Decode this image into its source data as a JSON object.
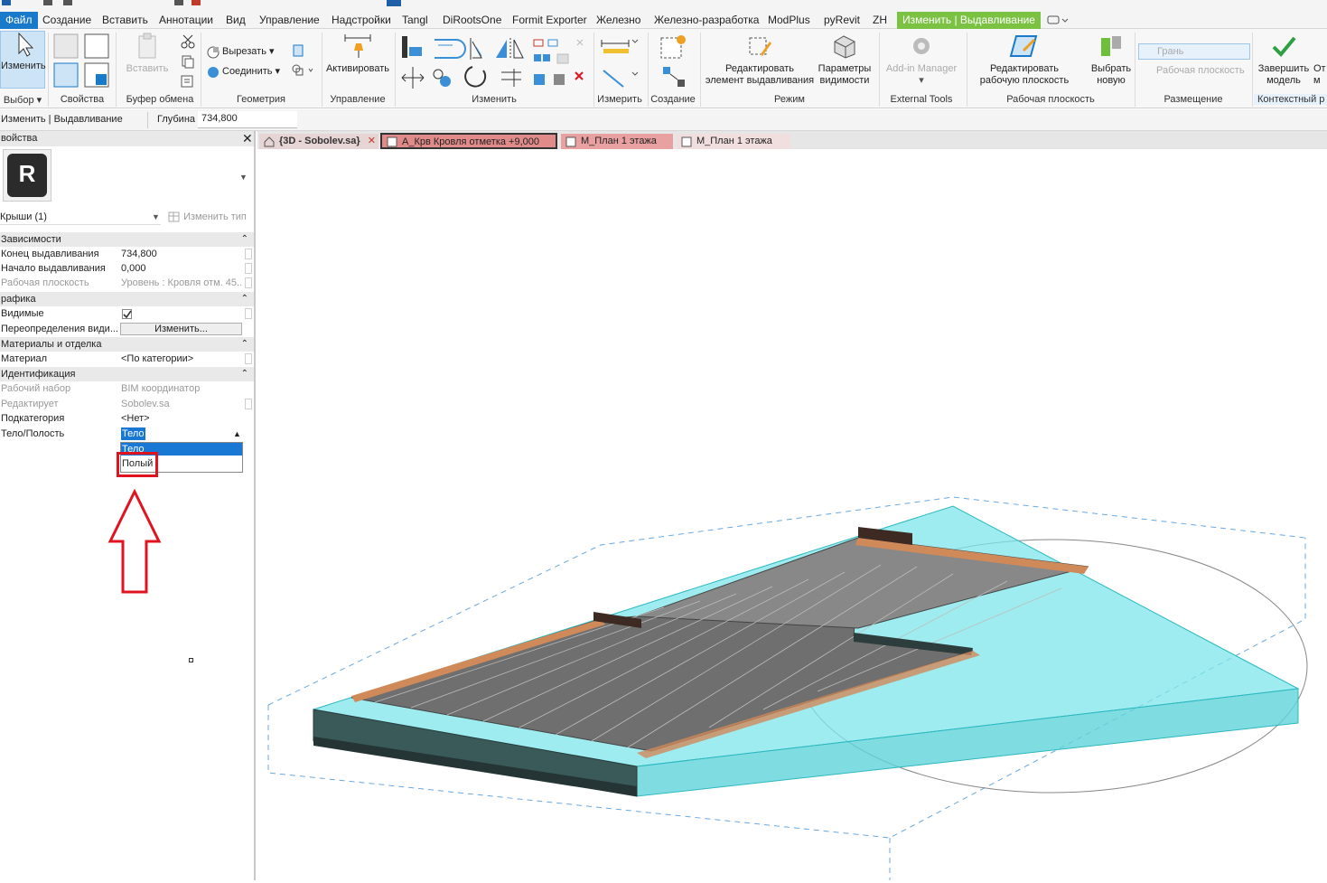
{
  "menubar": {
    "file": "Файл",
    "tabs": [
      "Создание",
      "Вставить",
      "Аннотации",
      "Вид",
      "Управление",
      "Надстройки",
      "Tangl",
      "DiRootsOne",
      "Formit Exporter",
      "Железно",
      "Железно-разработка",
      "ModPlus",
      "pyRevit",
      "ZH"
    ],
    "context_tab": "Изменить | Выдавливание"
  },
  "ribbon": {
    "modify": "Изменить",
    "paste": "Вставить",
    "cut": "Вырезать",
    "join": "Соединить",
    "activate": "Активировать",
    "edit_extrusion": "Редактировать\nэлемент выдавливания",
    "visibility_params": "Параметры\nвидимости",
    "addin_manager": "Add-in Manager",
    "edit_workplane": "Редактировать\nрабочую плоскость",
    "pick_new": "Выбрать\nновую",
    "face": "Грань",
    "workplane": "Рабочая плоскость",
    "finish_model": "Завершить\nмодель",
    "cancel_partial": "От\nм",
    "groups": {
      "select": "Выбор",
      "properties": "Свойства",
      "clipboard": "Буфер обмена",
      "geometry": "Геометрия",
      "manage": "Управление",
      "modify": "Изменить",
      "measure": "Измерить",
      "create": "Создание",
      "mode": "Режим",
      "external": "External Tools",
      "workplane": "Рабочая плоскость",
      "placement": "Размещение",
      "contextual": "Контекстный р"
    }
  },
  "optionsbar": {
    "context": "Изменить | Выдавливание",
    "depth_label": "Глубина",
    "depth_value": "734,800"
  },
  "properties": {
    "title": "войства",
    "type_selector": "Крыши (1)",
    "edit_type": "Изменить тип",
    "sections": {
      "constraints": "Зависимости",
      "graphics": "рафика",
      "materials": "Материалы и отделка",
      "identity": "Идентификация"
    },
    "rows": {
      "extrusion_end": {
        "name": "Конец выдавливания",
        "value": "734,800"
      },
      "extrusion_start": {
        "name": "Начало выдавливания",
        "value": "0,000"
      },
      "work_plane": {
        "name": "Рабочая плоскость",
        "value": "Уровень : Кровля отм. 45..."
      },
      "visible": {
        "name": "Видимые",
        "value": ""
      },
      "overrides": {
        "name": "Переопределения види...",
        "value": "Изменить..."
      },
      "material": {
        "name": "Материал",
        "value": "<По категории>"
      },
      "workset": {
        "name": "Рабочий набор",
        "value": "BIM координатор"
      },
      "edited_by": {
        "name": "Редактирует",
        "value": "Sobolev.sa"
      },
      "subcategory": {
        "name": "Подкатегория",
        "value": "<Нет>"
      },
      "solid_void": {
        "name": "Тело/Полость",
        "value": "Тело"
      }
    },
    "dropdown_options": [
      "Тело",
      "Полый"
    ]
  },
  "view_tabs": [
    {
      "label": "{3D - Sobolev.sa}"
    },
    {
      "label": "А_Крв Кровля отметка +9,000"
    },
    {
      "label": "М_План 1 этажа"
    },
    {
      "label": "М_План 1 этажа"
    }
  ],
  "colors": {
    "file_tab": "#1979ca",
    "context_tab": "#7bc142",
    "highlight_red": "#e0141e",
    "selection_blue": "#1978d4",
    "glass_cyan": "#7ee6ea"
  }
}
